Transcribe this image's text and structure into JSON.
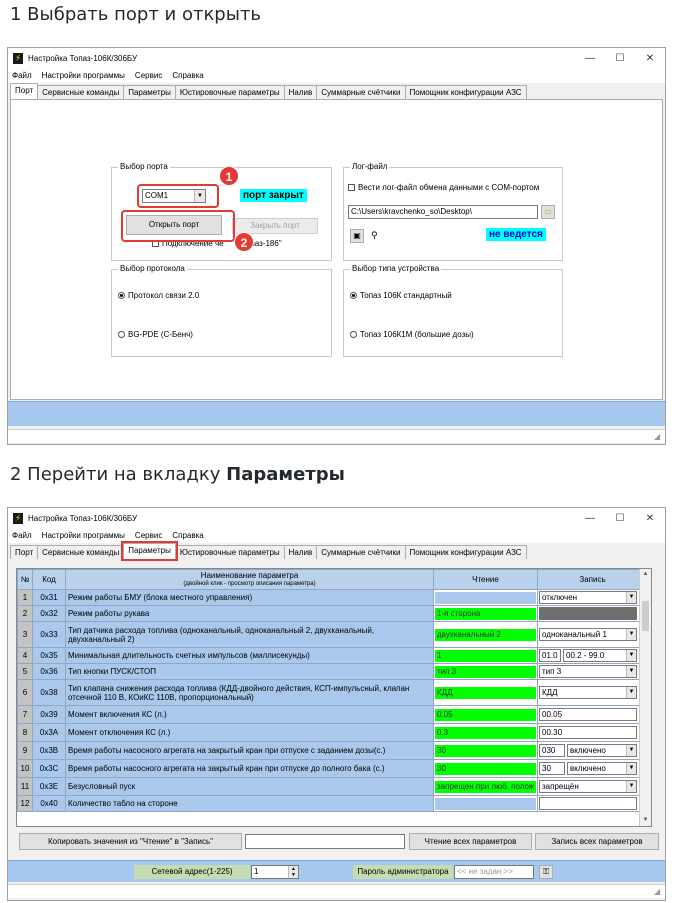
{
  "steps": {
    "step1": "1 Выбрать порт и открыть",
    "step2_prefix": "2 Перейти на вкладку ",
    "step2_bold": "Параметры"
  },
  "window": {
    "title": "Настройка Топаз-106К/306БУ",
    "minimize": "—",
    "maximize": "☐",
    "close": "✕"
  },
  "menu": [
    "Файл",
    "Настройки программы",
    "Сервис",
    "Справка"
  ],
  "tabs": [
    "Порт",
    "Сервисные команды",
    "Параметры",
    "Юстировочные параметры",
    "Налив",
    "Суммарные счётчики",
    "Помощник конфигурации АЗС"
  ],
  "port_tab": {
    "port_group": {
      "title": "Выбор порта",
      "selected_port": "COM1",
      "status": "порт закрыт",
      "open_button": "Открыть порт",
      "close_button": "Закрыть порт",
      "check_label": "Подключение че",
      "check_label_tail": "опаз-186\""
    },
    "log_group": {
      "title": "Лог-файл",
      "check_label": "Вести лог-файл обмена данными с COM-портом",
      "path": "C:\\Users\\kravchenko_so\\Desktop\\",
      "status": "не ведется"
    },
    "protocol_group": {
      "title": "Выбор протокола",
      "option1": "Протокол связи 2.0",
      "option2": "BG-PDE (С-Бенч)"
    },
    "device_group": {
      "title": "Выбор типа устройства",
      "option1": "Топаз 106К стандартный",
      "option2": "Топаз 106К1М (большие дозы)"
    }
  },
  "markers": {
    "m1": "1",
    "m2": "2"
  },
  "params_tab": {
    "headers": {
      "num": "№",
      "code": "Код",
      "name": "Наименование параметра",
      "name_sub": "(двойной клик - просмотр описания параметра)",
      "read": "Чтение",
      "write": "Запись"
    },
    "rows": [
      {
        "num": "1",
        "code": "0x31",
        "name": "Режим работы БМУ (блока местного управления)",
        "read": "",
        "write1": "отключен",
        "write2": ""
      },
      {
        "num": "2",
        "code": "0x32",
        "name": "Режим работы рукава",
        "read": "1-я сторона",
        "write1": "",
        "write2": ""
      },
      {
        "num": "3",
        "code": "0x33",
        "name": "Тип датчика расхода топлива (одноканальный, одноканальный 2, двухканальный, двухканальный 2)",
        "read": "двухканальный 2",
        "write1": "одноканальный 1",
        "write2": ""
      },
      {
        "num": "4",
        "code": "0x35",
        "name": "Минимальная длительность счетных импульсов (миллисекунды)",
        "read": "1",
        "write1": "01.0",
        "write2": "00.2 - 99.0"
      },
      {
        "num": "5",
        "code": "0x36",
        "name": "Тип кнопки ПУСК/СТОП",
        "read": "тип 3",
        "write1": "тип 3",
        "write2": ""
      },
      {
        "num": "6",
        "code": "0x38",
        "name": "Тип клапана снижения расхода топлива (КДД-двойного действия, КСП-импульсный, клапан отсечной 110 В, КОиКС 110В, пропорциональный)",
        "read": "КДД",
        "write1": "КДД",
        "write2": ""
      },
      {
        "num": "7",
        "code": "0x39",
        "name": "Момент включения КС (л.)",
        "read": "0.05",
        "write1": "00.05",
        "write2": ""
      },
      {
        "num": "8",
        "code": "0x3A",
        "name": "Момент отключения КС (л.)",
        "read": "0.3",
        "write1": "00.30",
        "write2": ""
      },
      {
        "num": "9",
        "code": "0x3B",
        "name": "Время работы насосного агрегата на закрытый кран при отпуске с заданием дозы(с.)",
        "read": "30",
        "write1": "030",
        "write2": "включено"
      },
      {
        "num": "10",
        "code": "0x3C",
        "name": "Время работы насосного агрегата на закрытый кран при отпуске до полного бака (с.)",
        "read": "30",
        "write1": "30",
        "write2": "включено"
      },
      {
        "num": "11",
        "code": "0x3E",
        "name": "Безусловный пуск",
        "read": "запрещен при люб. полож",
        "write1": "запрещён",
        "write2": ""
      },
      {
        "num": "12",
        "code": "0x40",
        "name": "Количество табло на стороне",
        "read": "",
        "write1": "",
        "write2": ""
      }
    ],
    "copy_button": "Копировать значения  из \"Чтение\" в \"Запись\"",
    "read_all_button": "Чтение всех параметров",
    "write_all_button": "Запись всех параметров",
    "network_label": "Сетевой адрес(1-225)",
    "network_value": "1",
    "admin_label": "Пароль администратора",
    "admin_placeholder": "<< не задан >>"
  }
}
